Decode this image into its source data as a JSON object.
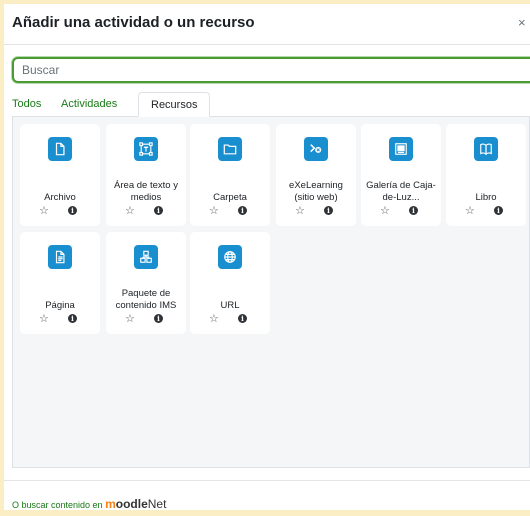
{
  "modal": {
    "title": "Añadir una actividad o un recurso",
    "close_glyph": "×"
  },
  "search": {
    "placeholder": "Buscar",
    "value": ""
  },
  "tabs": [
    {
      "label": "Todos",
      "active": false
    },
    {
      "label": "Actividades",
      "active": false
    },
    {
      "label": "Recursos",
      "active": true
    }
  ],
  "cards": [
    {
      "label": "Archivo",
      "icon": "file-icon"
    },
    {
      "label": "Área de texto y medios",
      "icon": "text-media-icon"
    },
    {
      "label": "Carpeta",
      "icon": "folder-icon"
    },
    {
      "label": "eXeLearning (sitio web)",
      "icon": "exelearning-icon"
    },
    {
      "label": "Galería de Caja-de-Luz...",
      "icon": "gallery-icon"
    },
    {
      "label": "Libro",
      "icon": "book-icon"
    },
    {
      "label": "Página",
      "icon": "page-icon"
    },
    {
      "label": "Paquete de contenido IMS",
      "icon": "ims-package-icon"
    },
    {
      "label": "URL",
      "icon": "globe-icon"
    }
  ],
  "card_actions": {
    "star_glyph": "☆",
    "info_glyph": "i"
  },
  "footer": {
    "prefix": "O buscar contenido en",
    "brand_m": "m",
    "brand_rest": "oodle",
    "brand_net": "Net"
  },
  "colors": {
    "accent_green": "#1a7a18",
    "icon_blue": "#1a8fcf",
    "focus_border": "#4a9a36",
    "moodle_orange": "#f98012"
  }
}
